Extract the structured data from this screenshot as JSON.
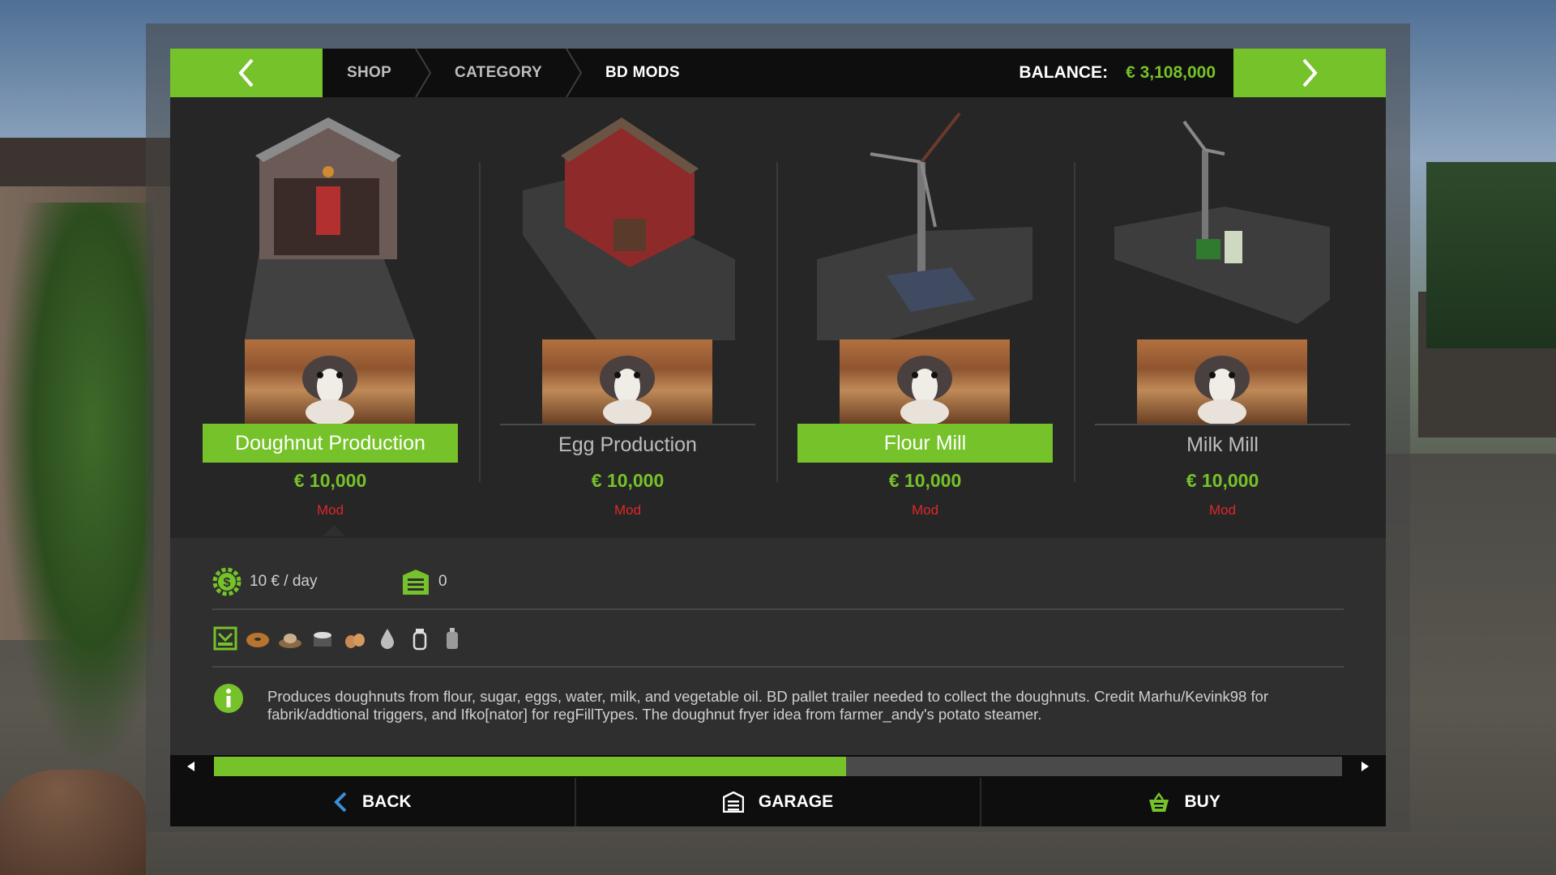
{
  "breadcrumb": {
    "items": [
      "SHOP",
      "CATEGORY",
      "BD MODS"
    ]
  },
  "balance": {
    "label": "BALANCE:",
    "value": "€ 3,108,000"
  },
  "items": [
    {
      "name": "Doughnut Production",
      "price": "€ 10,000",
      "tag": "Mod",
      "selected": true
    },
    {
      "name": "Egg Production",
      "price": "€ 10,000",
      "tag": "Mod",
      "selected": false
    },
    {
      "name": "Flour Mill",
      "price": "€ 10,000",
      "tag": "Mod",
      "selected": true
    },
    {
      "name": "Milk Mill",
      "price": "€ 10,000",
      "tag": "Mod",
      "selected": false
    }
  ],
  "details": {
    "upkeep": "10 € / day",
    "owned_count": "0",
    "fill_icons": [
      "silo-icon",
      "doughnut-icon",
      "flour-icon",
      "sugar-icon",
      "eggs-icon",
      "water-icon",
      "milk-icon",
      "oil-icon"
    ],
    "description": "Produces doughnuts from flour, sugar, eggs, water, milk, and vegetable oil. BD pallet trailer needed to collect the doughnuts. Credit Marhu/Kevink98 for fabrik/addtional triggers, and Ifko[nator] for regFillTypes. The doughnut fryer idea from farmer_andy's potato steamer."
  },
  "scrollbar": {
    "position_fraction": 0.56
  },
  "bottom_bar": {
    "back": "BACK",
    "garage": "GARAGE",
    "buy": "BUY"
  },
  "colors": {
    "accent": "#76c22a",
    "mod_tag": "#e0262a",
    "back_arrow": "#3a8fd8"
  }
}
